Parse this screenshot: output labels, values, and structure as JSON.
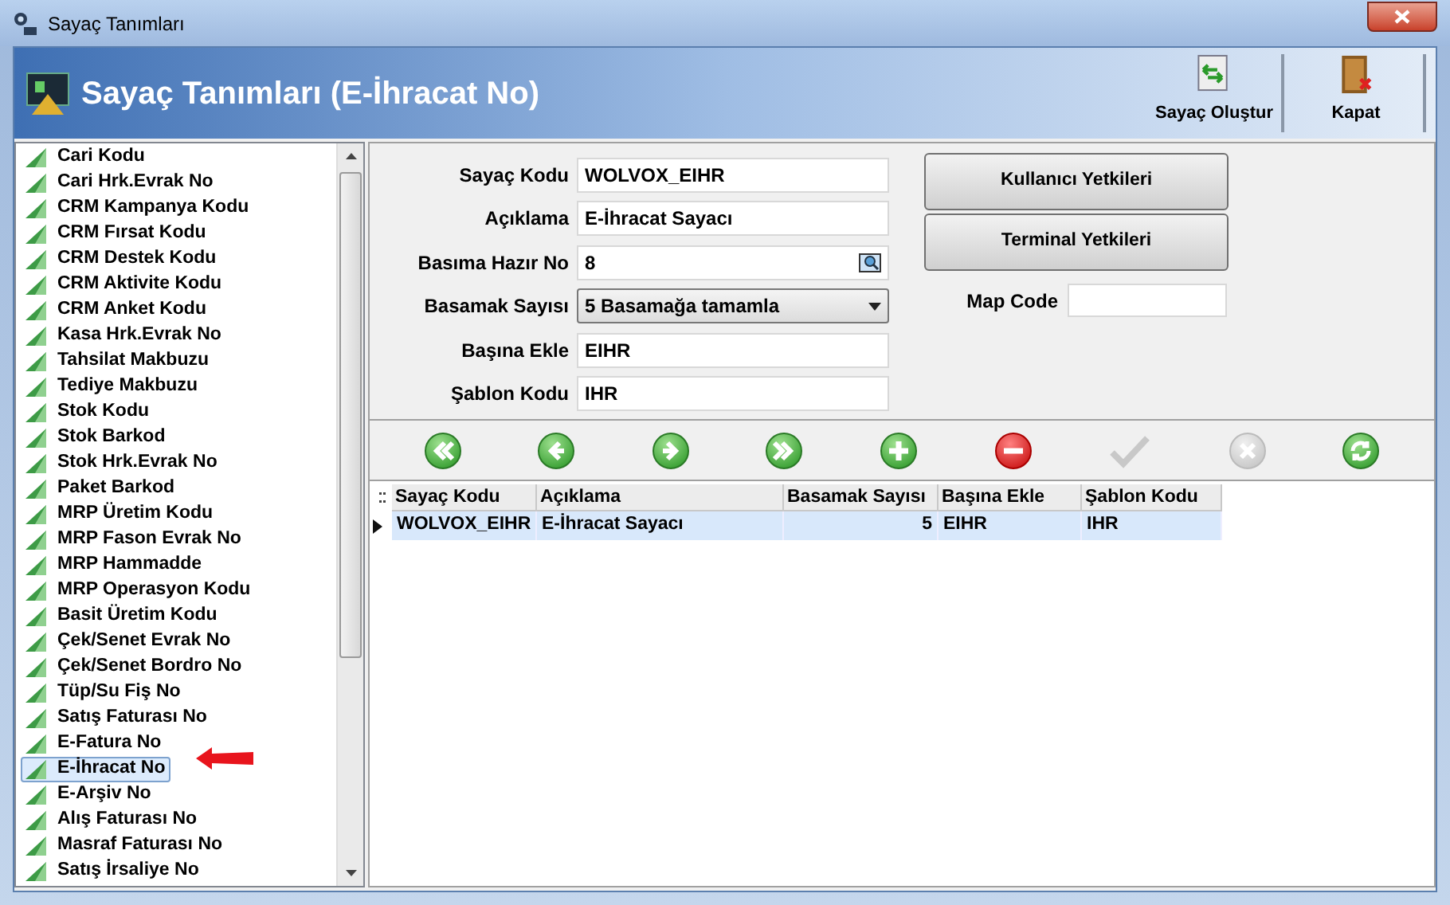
{
  "window": {
    "title": "Sayaç Tanımları"
  },
  "header": {
    "title": "Sayaç Tanımları (E-İhracat No)",
    "actions": [
      {
        "kind": "create",
        "label": "Sayaç Oluştur"
      },
      {
        "kind": "close",
        "label": "Kapat"
      }
    ]
  },
  "sidebar": {
    "items": [
      {
        "label": "Cari Kodu",
        "selected": false
      },
      {
        "label": "Cari Hrk.Evrak No",
        "selected": false
      },
      {
        "label": "CRM Kampanya Kodu",
        "selected": false
      },
      {
        "label": "CRM Fırsat Kodu",
        "selected": false
      },
      {
        "label": "CRM Destek Kodu",
        "selected": false
      },
      {
        "label": "CRM Aktivite Kodu",
        "selected": false
      },
      {
        "label": "CRM Anket Kodu",
        "selected": false
      },
      {
        "label": "Kasa Hrk.Evrak No",
        "selected": false
      },
      {
        "label": "Tahsilat Makbuzu",
        "selected": false
      },
      {
        "label": "Tediye Makbuzu",
        "selected": false
      },
      {
        "label": "Stok Kodu",
        "selected": false
      },
      {
        "label": "Stok Barkod",
        "selected": false
      },
      {
        "label": "Stok Hrk.Evrak No",
        "selected": false
      },
      {
        "label": "Paket Barkod",
        "selected": false
      },
      {
        "label": "MRP Üretim Kodu",
        "selected": false
      },
      {
        "label": "MRP Fason Evrak No",
        "selected": false
      },
      {
        "label": "MRP Hammadde",
        "selected": false
      },
      {
        "label": "MRP Operasyon Kodu",
        "selected": false
      },
      {
        "label": "Basit Üretim Kodu",
        "selected": false
      },
      {
        "label": "Çek/Senet Evrak No",
        "selected": false
      },
      {
        "label": "Çek/Senet Bordro No",
        "selected": false
      },
      {
        "label": "Tüp/Su Fiş No",
        "selected": false
      },
      {
        "label": "Satış Faturası No",
        "selected": false
      },
      {
        "label": "E-Fatura No",
        "selected": false
      },
      {
        "label": "E-İhracat No",
        "selected": true
      },
      {
        "label": "E-Arşiv No",
        "selected": false
      },
      {
        "label": "Alış Faturası No",
        "selected": false
      },
      {
        "label": "Masraf Faturası No",
        "selected": false
      },
      {
        "label": "Satış İrsaliye No",
        "selected": false
      }
    ]
  },
  "form": {
    "fields": [
      {
        "kind": "text",
        "label": "Sayaç Kodu",
        "value": "WOLVOX_EIHR"
      },
      {
        "kind": "text",
        "label": "Açıklama",
        "value": "E-İhracat Sayacı"
      },
      {
        "kind": "lookup",
        "label": "Basıma Hazır No",
        "value": "8"
      },
      {
        "kind": "select",
        "label": "Basamak Sayısı",
        "value": "5 Basamağa tamamla"
      },
      {
        "kind": "text",
        "label": "Başına Ekle",
        "value": "EIHR"
      },
      {
        "kind": "text",
        "label": "Şablon Kodu",
        "value": "IHR"
      }
    ],
    "buttons": [
      "Kullanıcı Yetkileri",
      "Terminal Yetkileri"
    ],
    "map_code": {
      "label": "Map Code"
    }
  },
  "navigator": [
    {
      "kind": "first",
      "disabled": false
    },
    {
      "kind": "prior",
      "disabled": false
    },
    {
      "kind": "next",
      "disabled": false
    },
    {
      "kind": "last",
      "disabled": false
    },
    {
      "kind": "add",
      "disabled": false
    },
    {
      "kind": "delete",
      "disabled": false
    },
    {
      "kind": "post",
      "disabled": true
    },
    {
      "kind": "cancel",
      "disabled": true
    },
    {
      "kind": "refresh",
      "disabled": false
    }
  ],
  "table": {
    "columns": [
      "Sayaç Kodu",
      "Açıklama",
      "Basamak Sayısı",
      "Başına Ekle",
      "Şablon Kodu"
    ],
    "rows": [
      {
        "cells": [
          "WOLVOX_EIHR",
          "E-İhracat Sayacı",
          "5",
          "EIHR",
          "IHR"
        ],
        "selected": true
      }
    ]
  }
}
